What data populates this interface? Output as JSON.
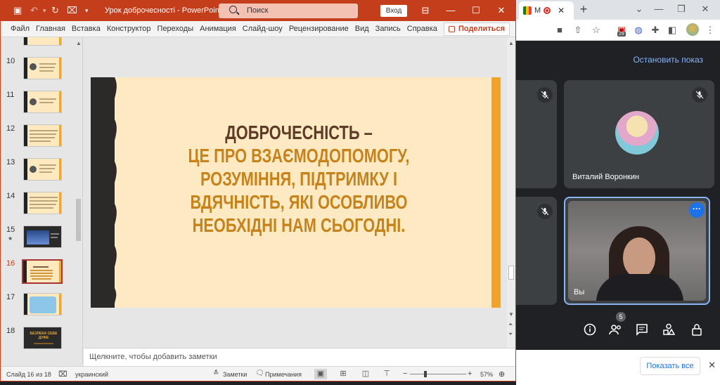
{
  "ppt": {
    "doc_title": "Урок доброчесності",
    "app_sep": "-",
    "app_name": "PowerPoint",
    "search_placeholder": "Поиск",
    "login_label": "Вход",
    "ribbon_tabs": [
      "Файл",
      "Главная",
      "Вставка",
      "Конструктор",
      "Переходы",
      "Анимация",
      "Слайд-шоу",
      "Рецензирование",
      "Вид",
      "Запись",
      "Справка"
    ],
    "share_label": "Поделиться",
    "thumbnails": [
      {
        "num": "10"
      },
      {
        "num": "11"
      },
      {
        "num": "12"
      },
      {
        "num": "13"
      },
      {
        "num": "14"
      },
      {
        "num": "15",
        "star": "★"
      },
      {
        "num": "16"
      },
      {
        "num": "17"
      },
      {
        "num": "18"
      }
    ],
    "thumb_dark_title": "БЕЗПЕКА СЕБЕ ДУЖЕ",
    "slide": {
      "line1": "ДОБРОЧЕСНІСТЬ –",
      "line2": "ЦЕ ПРО ВЗАЄМОДОПОМОГУ,",
      "line3": "РОЗУМІННЯ, ПІДТРИМКУ І",
      "line4": "ВДЯЧНІСТЬ, ЯКІ ОСОБЛИВО",
      "line5": "НЕОБХІДНІ НАМ СЬОГОДНІ."
    },
    "notes_placeholder": "Щелкните, чтобы добавить заметки",
    "status": {
      "slide_counter": "Слайд 16 из 18",
      "language": "украинский",
      "notes_label": "Заметки",
      "comments_label": "Примечания",
      "zoom": "57%"
    },
    "colors": {
      "accent": "#c43e1c",
      "slide_dark": "#5e3b26",
      "slide_orange": "#c7821b",
      "slide_bg": "#fdeac2"
    }
  },
  "chrome": {
    "tab_title": "M",
    "stop_presenting": "Остановить показ",
    "participants": [
      {
        "name": "Виталий Воронкин"
      },
      {
        "name": "Вы"
      }
    ],
    "people_count": "5",
    "show_all": "Показать все",
    "ext_badge": "29"
  }
}
